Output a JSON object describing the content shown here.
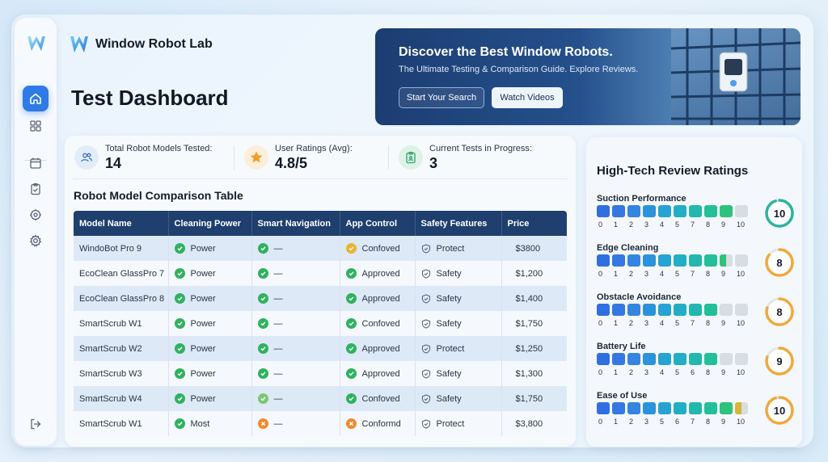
{
  "app": {
    "name": "Window Robot Lab",
    "page_title": "Test Dashboard"
  },
  "sidebar": {
    "items": [
      {
        "name": "home",
        "icon": "home-icon",
        "active": true
      },
      {
        "name": "grid",
        "icon": "grid-icon",
        "active": false
      },
      {
        "name": "calendar",
        "icon": "calendar-icon",
        "active": false
      },
      {
        "name": "clipboard",
        "icon": "clipboard-check-icon",
        "active": false
      },
      {
        "name": "robot",
        "icon": "robot-icon",
        "active": false
      },
      {
        "name": "settings",
        "icon": "gear-icon",
        "active": false
      },
      {
        "name": "logout",
        "icon": "logout-icon",
        "active": false
      }
    ]
  },
  "banner": {
    "title": "Discover the Best Window Robots.",
    "subtitle": "The Ultimate Testing & Comparison Guide. Explore Reviews.",
    "primary_button": "Start Your Search",
    "secondary_button": "Watch Videos"
  },
  "stats": [
    {
      "label": "Total Robot Models Tested:",
      "value": "14",
      "icon": "users-icon",
      "color": "#5b8fd8"
    },
    {
      "label": "User Ratings (Avg):",
      "value": "4.8/5",
      "icon": "star-icon",
      "color": "#f0a020"
    },
    {
      "label": "Current Tests in Progress:",
      "value": "3",
      "icon": "clipboard-icon",
      "color": "#2fa66a"
    }
  ],
  "table": {
    "title": "Robot Model Comparison Table",
    "columns": [
      "Model Name",
      "Cleaning Power",
      "Smart Navigation",
      "App Control",
      "Safety Features",
      "Price"
    ],
    "rows": [
      {
        "model": "WindoBot Pro 9",
        "power": "Power",
        "power_status": "ok",
        "nav": "—",
        "nav_status": "ok",
        "app": "Confoved",
        "app_status": "warn",
        "safety": "Protect",
        "price": "$3800"
      },
      {
        "model": "EcoClean GlassPro 7",
        "power": "Power",
        "power_status": "ok",
        "nav": "—",
        "nav_status": "ok",
        "app": "Approved",
        "app_status": "ok",
        "safety": "Safety",
        "price": "$1,200"
      },
      {
        "model": "EcoClean GlassPro 8",
        "power": "Power",
        "power_status": "ok",
        "nav": "—",
        "nav_status": "ok",
        "app": "Approved",
        "app_status": "ok",
        "safety": "Safety",
        "price": "$1,400"
      },
      {
        "model": "SmartScrub W1",
        "power": "Power",
        "power_status": "ok",
        "nav": "—",
        "nav_status": "ok",
        "app": "Confoved",
        "app_status": "ok",
        "safety": "Safety",
        "price": "$1,750"
      },
      {
        "model": "SmartScrub W2",
        "power": "Power",
        "power_status": "ok",
        "nav": "—",
        "nav_status": "ok",
        "app": "Approved",
        "app_status": "ok",
        "safety": "Protect",
        "price": "$1,250"
      },
      {
        "model": "SmartScrub W3",
        "power": "Power",
        "power_status": "ok",
        "nav": "—",
        "nav_status": "ok",
        "app": "Approved",
        "app_status": "ok",
        "safety": "Safety",
        "price": "$1,300"
      },
      {
        "model": "SmartScrub W4",
        "power": "Power",
        "power_status": "ok",
        "nav": "—",
        "nav_status": "light",
        "app": "Confoved",
        "app_status": "ok",
        "safety": "Safety",
        "price": "$1,750"
      },
      {
        "model": "SmartScrub W1",
        "power": "Most",
        "power_status": "ok",
        "nav": "—",
        "nav_status": "fail",
        "app": "Conformd",
        "app_status": "fail",
        "safety": "Protect",
        "price": "$3,800"
      }
    ]
  },
  "ratings": {
    "title": "High-Tech Review Ratings",
    "items": [
      {
        "label": "Suction Performance",
        "score": "10",
        "filled": 9.5,
        "scale": [
          "0",
          "1",
          "2",
          "3",
          "4",
          "5",
          "7",
          "8",
          "9",
          "10"
        ],
        "ring": "#2bb5a0"
      },
      {
        "label": "Edge Cleaning",
        "score": "8",
        "filled": 8.5,
        "scale": [
          "0",
          "1",
          "2",
          "3",
          "4",
          "5",
          "7",
          "8",
          "9",
          "10"
        ],
        "ring": "#f2a93b"
      },
      {
        "label": "Obstacle Avoidance",
        "score": "8",
        "filled": 8,
        "scale": [
          "0",
          "1",
          "2",
          "3",
          "4",
          "5",
          "7",
          "8",
          "9",
          "10"
        ],
        "ring": "#f2a93b"
      },
      {
        "label": "Battery Life",
        "score": "9",
        "filled": 8,
        "scale": [
          "0",
          "1",
          "2",
          "3",
          "4",
          "5",
          "6",
          "8",
          "9",
          "10"
        ],
        "ring": "#f2a93b"
      },
      {
        "label": "Ease of Use",
        "score": "10",
        "filled": 9.5,
        "scale": [
          "0",
          "1",
          "2",
          "3",
          "5",
          "6",
          "7",
          "8",
          "9",
          "10"
        ],
        "ring": "#f2a93b"
      }
    ]
  },
  "colors": {
    "accent": "#2f7be5",
    "table_header": "#1f3f6e",
    "ok": "#2fb25e",
    "warn": "#f0a020",
    "fail": "#f28a30"
  }
}
